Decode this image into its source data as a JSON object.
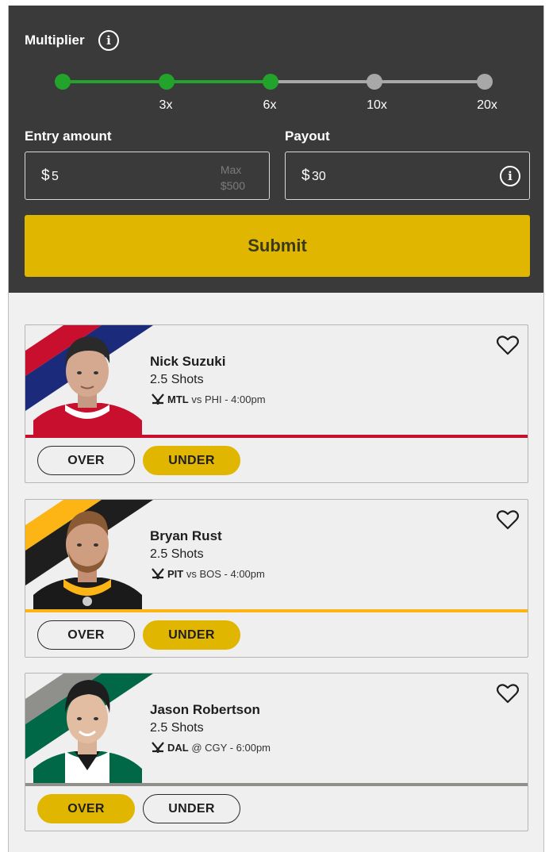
{
  "multiplier": {
    "title": "Multiplier",
    "steps": [
      "",
      "3x",
      "6x",
      "10x",
      "20x"
    ],
    "selected_level": 2,
    "active_color": "#22a32b",
    "inactive_color": "#a8a8a8"
  },
  "entry": {
    "label": "Entry amount",
    "currency": "$",
    "value": "5",
    "max_label": "Max",
    "max_value": "$500"
  },
  "payout": {
    "label": "Payout",
    "currency": "$",
    "value": "30"
  },
  "submit_label": "Submit",
  "accent_color": "#e1b600",
  "players": [
    {
      "name": "Nick Suzuki",
      "stat": "2.5 Shots",
      "team": "MTL",
      "matchup": "vs PHI - 4:00pm",
      "team_colors": [
        "#c8102e",
        "#1b2a7a"
      ],
      "divider_color": "#c8102e",
      "over_label": "OVER",
      "under_label": "UNDER",
      "selected": "under"
    },
    {
      "name": "Bryan Rust",
      "stat": "2.5 Shots",
      "team": "PIT",
      "matchup": "vs BOS - 4:00pm",
      "team_colors": [
        "#fcb514",
        "#1e1e1e"
      ],
      "divider_color": "#fcb514",
      "over_label": "OVER",
      "under_label": "UNDER",
      "selected": "under"
    },
    {
      "name": "Jason Robertson",
      "stat": "2.5 Shots",
      "team": "DAL",
      "matchup": "@ CGY - 6:00pm",
      "team_colors": [
        "#8f8f8c",
        "#006847"
      ],
      "divider_color": "#8f8f8c",
      "over_label": "OVER",
      "under_label": "UNDER",
      "selected": "over"
    }
  ]
}
